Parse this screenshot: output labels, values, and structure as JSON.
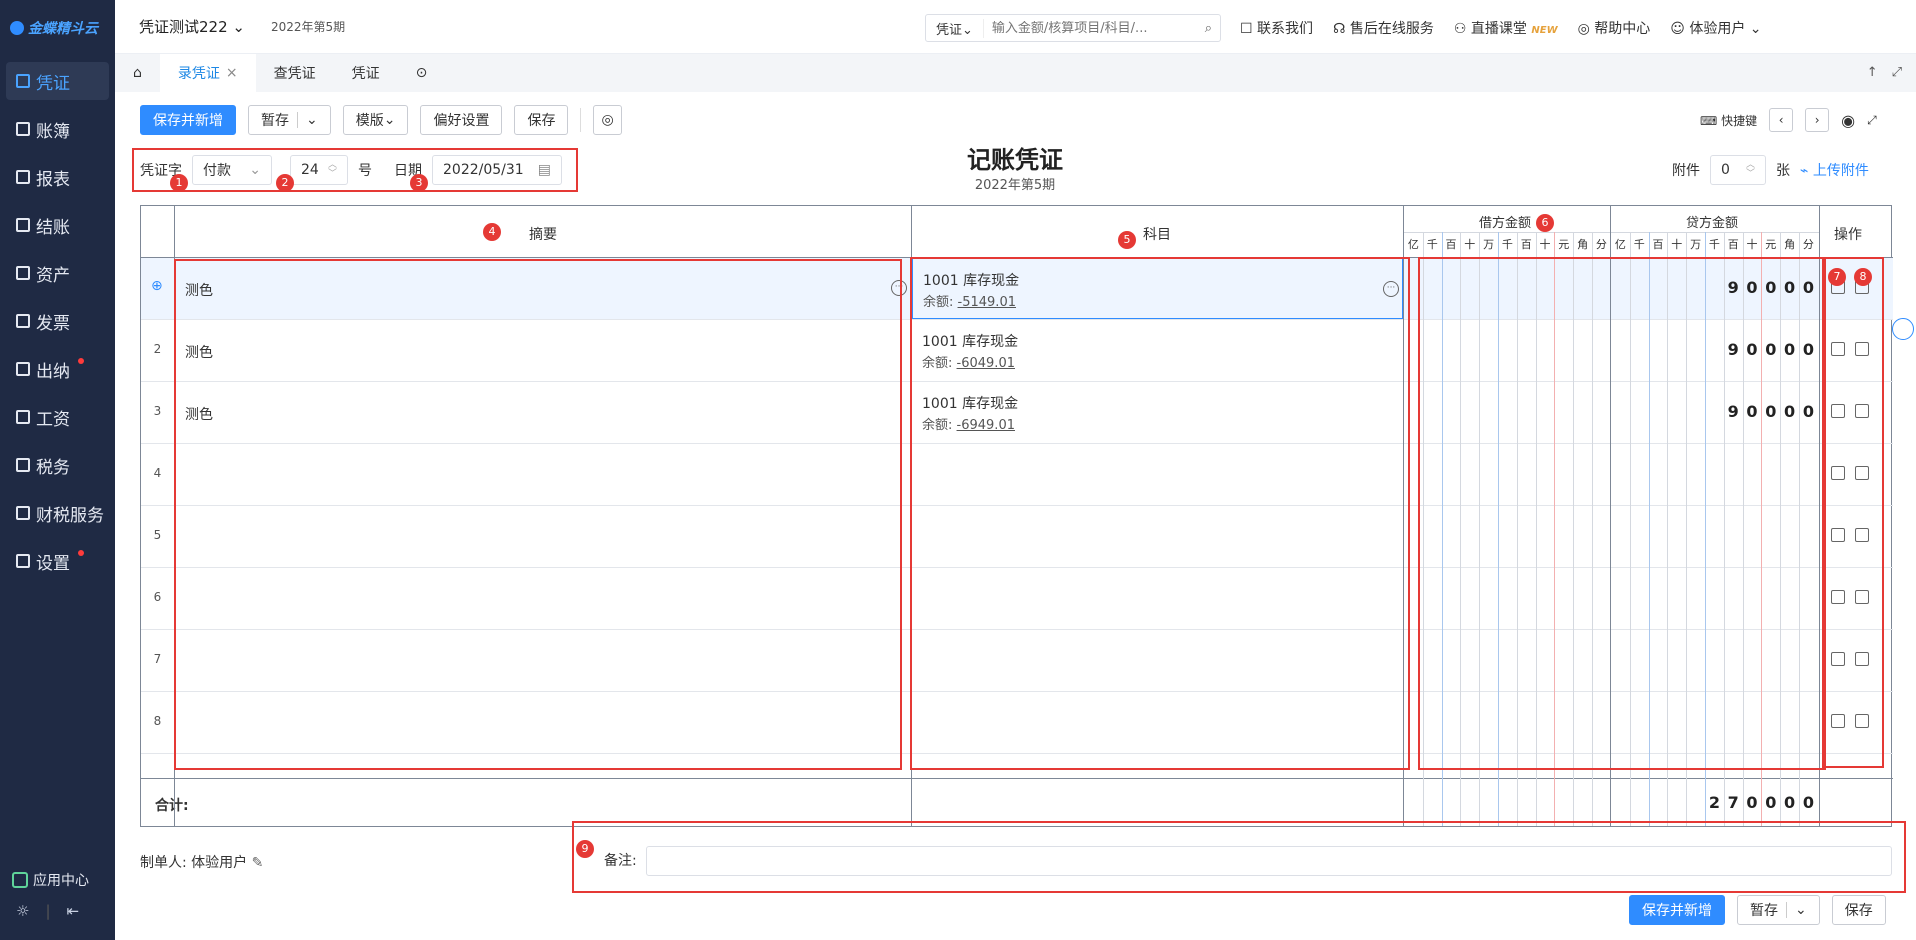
{
  "sidebar": {
    "logo": "金蝶精斗云",
    "items": [
      {
        "label": "凭证",
        "active": true,
        "dot": false
      },
      {
        "label": "账簿",
        "active": false,
        "dot": false
      },
      {
        "label": "报表",
        "active": false,
        "dot": false
      },
      {
        "label": "结账",
        "active": false,
        "dot": false
      },
      {
        "label": "资产",
        "active": false,
        "dot": false
      },
      {
        "label": "发票",
        "active": false,
        "dot": false
      },
      {
        "label": "出纳",
        "active": false,
        "dot": true
      },
      {
        "label": "工资",
        "active": false,
        "dot": false
      },
      {
        "label": "税务",
        "active": false,
        "dot": false
      },
      {
        "label": "财税服务",
        "active": false,
        "dot": false
      },
      {
        "label": "设置",
        "active": false,
        "dot": true
      }
    ],
    "app_center": "应用中心"
  },
  "topbar": {
    "account": "凭证测试222",
    "period": "2022年第5期",
    "search_scope": "凭证",
    "search_placeholder": "输入金额/核算项目/科目/...",
    "links": [
      "联系我们",
      "售后在线服务",
      "直播课堂",
      "帮助中心",
      "体验用户"
    ],
    "new_badge": "NEW"
  },
  "tabs": [
    "录凭证",
    "查凭证",
    "凭证"
  ],
  "toolbar": {
    "save_new": "保存并新增",
    "temp_save": "暂存",
    "template": "模版",
    "preferences": "偏好设置",
    "save": "保存",
    "shortcut": "快捷键"
  },
  "voucher": {
    "word_label": "凭证字",
    "word_value": "付款",
    "number": "24",
    "number_suffix": "号",
    "date_label": "日期",
    "date": "2022/05/31",
    "title": "记账凭证",
    "period": "2022年第5期",
    "attach_label": "附件",
    "attach_count": "0",
    "attach_unit": "张",
    "upload": "上传附件"
  },
  "table": {
    "col_summary": "摘要",
    "col_account": "科目",
    "col_debit": "借方金额",
    "col_credit": "贷方金额",
    "col_ops": "操作",
    "digits": [
      "亿",
      "千",
      "百",
      "十",
      "万",
      "千",
      "百",
      "十",
      "元",
      "角",
      "分"
    ],
    "rows": [
      {
        "num": "",
        "summary": "测色",
        "account": "1001  库存现金",
        "balance_label": "余额:",
        "balance": "-5149.01",
        "credit": "90000"
      },
      {
        "num": "2",
        "summary": "测色",
        "account": "1001  库存现金",
        "balance_label": "余额:",
        "balance": "-6049.01",
        "credit": "90000"
      },
      {
        "num": "3",
        "summary": "测色",
        "account": "1001  库存现金",
        "balance_label": "余额:",
        "balance": "-6949.01",
        "credit": "90000"
      },
      {
        "num": "4",
        "summary": "",
        "account": "",
        "balance_label": "",
        "balance": "",
        "credit": ""
      },
      {
        "num": "5",
        "summary": "",
        "account": "",
        "balance_label": "",
        "balance": "",
        "credit": ""
      },
      {
        "num": "6",
        "summary": "",
        "account": "",
        "balance_label": "",
        "balance": "",
        "credit": ""
      },
      {
        "num": "7",
        "summary": "",
        "account": "",
        "balance_label": "",
        "balance": "",
        "credit": ""
      },
      {
        "num": "8",
        "summary": "",
        "account": "",
        "balance_label": "",
        "balance": "",
        "credit": ""
      }
    ],
    "total_label": "合计:",
    "total_credit": "270000"
  },
  "footer": {
    "maker_label": "制单人:",
    "maker": "体验用户",
    "remark_label": "备注:",
    "save_new": "保存并新增",
    "temp_save": "暂存",
    "save": "保存"
  },
  "annotations": [
    "1",
    "2",
    "3",
    "4",
    "5",
    "6",
    "7",
    "8",
    "9"
  ],
  "colors": {
    "accent": "#2f8cff",
    "sidebar": "#1f2a44",
    "annotation": "#e53935"
  }
}
